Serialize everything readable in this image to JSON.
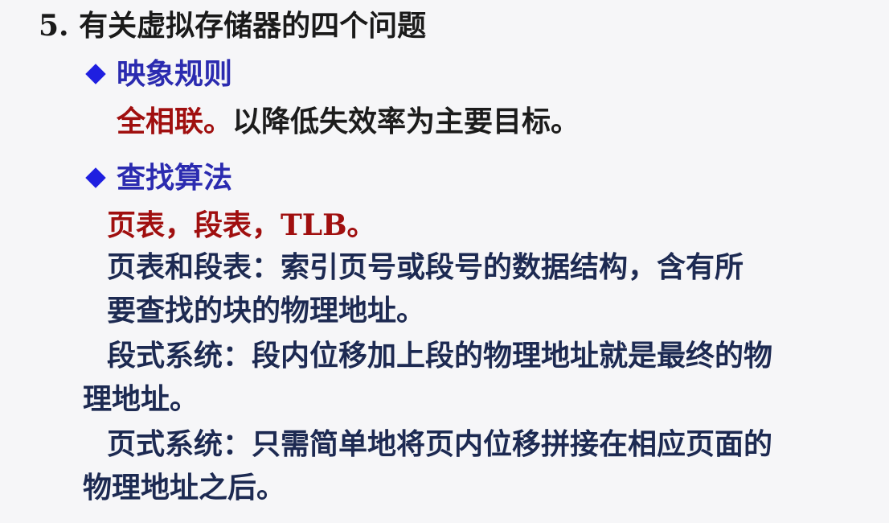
{
  "title": "5. 有关虚拟存储器的四个问题",
  "section1": {
    "heading": "映象规则",
    "highlight": "全相联。",
    "text": "以降低失效率为主要目标。"
  },
  "section2": {
    "heading": "查找算法",
    "highlight": "页表，段表，TLB。",
    "lines": [
      "页表和段表：索引页号或段号的数据结构，含有所",
      "要查找的块的物理地址。",
      "段式系统：段内位移加上段的物理地址就是最终的物",
      "理地址。",
      "页式系统：只需简单地将页内位移拼接在相应页面的",
      "物理地址之后。"
    ]
  },
  "colors": {
    "heading_blue": "#2b2bb0",
    "highlight_red": "#a00f0f",
    "body_text": "#1c1c1c"
  }
}
